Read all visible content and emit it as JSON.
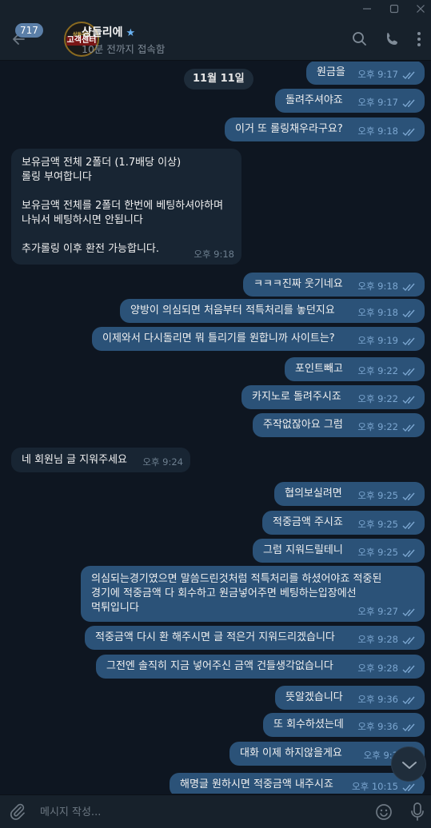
{
  "window": {
    "minimize_icon": "minimize-icon",
    "maximize_icon": "maximize-icon",
    "close_icon": "close-icon"
  },
  "header": {
    "unread_count": "717",
    "avatar_text_top": "상들리에",
    "avatar_text_mid": "고객센터",
    "avatar_text_bottom": "",
    "chat_name": "샹들리에",
    "star": "★",
    "status": "10분 전까지 접속함"
  },
  "date_divider": "11월 11일",
  "messages": [
    {
      "dir": "out",
      "text": "원금을",
      "time": "오후 9:17"
    },
    {
      "dir": "out",
      "text": "돌려주셔야죠",
      "time": "오후 9:17"
    },
    {
      "dir": "out",
      "text": "이거 또 롤링채우라구요?",
      "time": "오후 9:18"
    },
    {
      "dir": "in",
      "lines": [
        "보유금액 전체 2폴더 (1.7배당 이상)",
        "롤링 부여합니다",
        "",
        "보유금액 전체를 2폴더 한번에 베팅하셔야하며",
        "나눠서 베팅하시면 안됩니다",
        "",
        "추가롤링 이후 환전 가능합니다."
      ],
      "time": "오후 9:18"
    },
    {
      "dir": "out",
      "text": "ㅋㅋㅋ진짜 웃기네요",
      "time": "오후 9:18"
    },
    {
      "dir": "out",
      "text": "양방이 의심되면 처음부터 적특처리를 놓던지요",
      "time": "오후 9:18"
    },
    {
      "dir": "out",
      "text": "이제와서 다시돌리면 뭐 틀리기를 원합니까 사이트는?",
      "time": "오후 9:19"
    },
    {
      "dir": "out",
      "text": "포인트빼고",
      "time": "오후 9:22"
    },
    {
      "dir": "out",
      "text": "카지노로 돌려주시죠",
      "time": "오후 9:22"
    },
    {
      "dir": "out",
      "text": "주작없잖아요 그럼",
      "time": "오후 9:22"
    },
    {
      "dir": "in",
      "text": "네 회원님 글 지워주세요",
      "time": "오후 9:24"
    },
    {
      "dir": "out",
      "text": "협의보실려면",
      "time": "오후 9:25"
    },
    {
      "dir": "out",
      "text": "적중금액 주시죠",
      "time": "오후 9:25"
    },
    {
      "dir": "out",
      "text": "그럼 지워드릴테니",
      "time": "오후 9:25"
    },
    {
      "dir": "out",
      "lines": [
        "의심되는경기였으면 말씀드린것처럼 적특처리를 하셨어야죠 적중된",
        "경기에 적중금액 다 회수하고 원금넣어주면 베팅하는입장에선",
        "먹튀입니다"
      ],
      "time": "오후 9:27"
    },
    {
      "dir": "out",
      "text": "적중금액 다시 환 해주시면 글 적은거 지워드리겠습니다",
      "time": "오후 9:28"
    },
    {
      "dir": "out",
      "text": "그전엔 솔직히 지금 넣어주신 금액 건들생각없습니다",
      "time": "오후 9:28"
    },
    {
      "dir": "out",
      "text": "뜻알겠습니다",
      "time": "오후 9:36"
    },
    {
      "dir": "out",
      "text": "또 회수하셨는데",
      "time": "오후 9:36"
    },
    {
      "dir": "out",
      "text": "대화 이제 하지않을게요",
      "time": "오후 9:3"
    },
    {
      "dir": "out",
      "text": "해명글 원하시면 적중금액 내주시죠",
      "time": "오후 10:15"
    }
  ],
  "composer": {
    "placeholder": "메시지 작성..."
  },
  "colors": {
    "background": "#0e1621",
    "header": "#17212b",
    "outgoing_bubble": "#2b5278",
    "incoming_bubble": "#182533",
    "accent": "#6ab2f2"
  }
}
